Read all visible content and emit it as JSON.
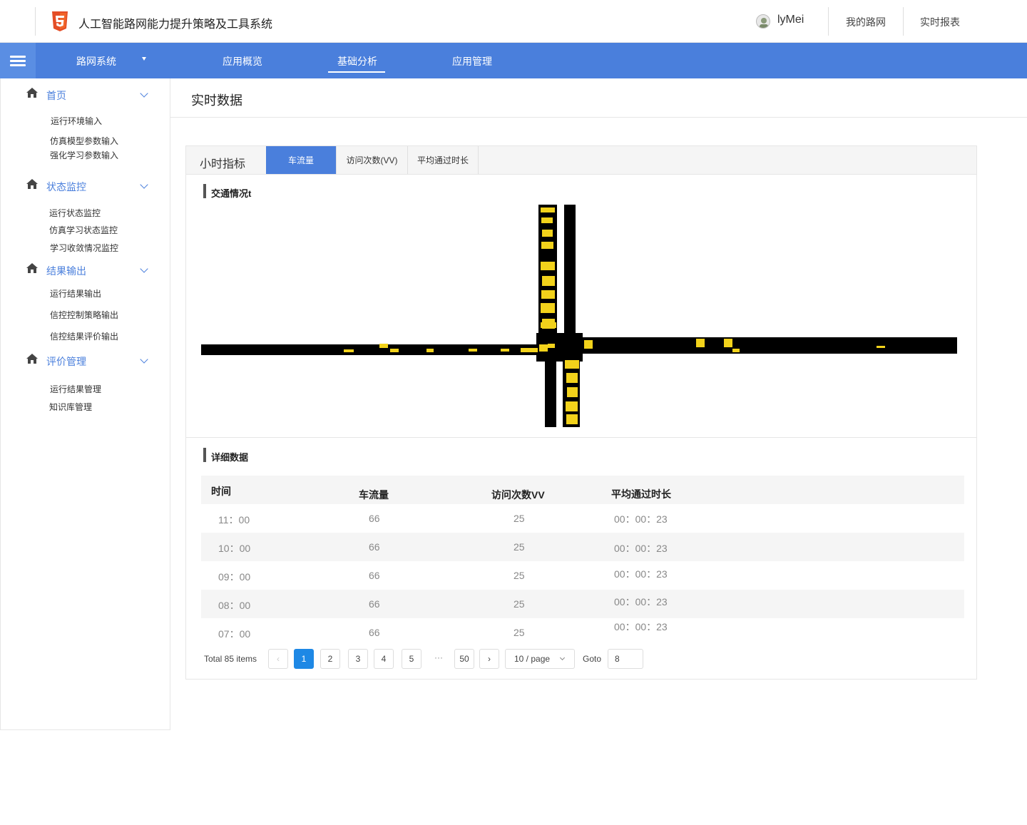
{
  "header": {
    "app_title": "人工智能路网能力提升策略及工具系统",
    "username": "lyMei",
    "links": [
      "我的路网",
      "实时报表"
    ]
  },
  "nav": {
    "system_label": "路网系统",
    "items": [
      "应用概览",
      "基础分析",
      "应用管理"
    ],
    "active": "基础分析",
    "accent_color": "#4a7fdc"
  },
  "sidebar": {
    "sections": [
      {
        "title": "首页",
        "icon": "home-icon",
        "items": [
          "运行环境输入",
          "仿真模型参数输入",
          "强化学习参数输入"
        ]
      },
      {
        "title": "状态监控",
        "icon": "home-icon",
        "items": [
          "运行状态监控",
          "仿真学习状态监控",
          "学习收敛情况监控"
        ]
      },
      {
        "title": "结果输出",
        "icon": "home-icon",
        "items": [
          "运行结果输出",
          "信控控制策略输出",
          "信控结果评价输出"
        ]
      },
      {
        "title": "评价管理",
        "icon": "home-icon",
        "items": [
          "运行结果管理",
          "知识库管理"
        ]
      }
    ]
  },
  "page": {
    "title": "实时数据",
    "tabs_label": "小时指标",
    "tabs": [
      "车流量",
      "访问次数(VV)",
      "平均通过时长"
    ],
    "active_tab": "车流量",
    "traffic_section": "交通情况t",
    "detail_section": "详细数据"
  },
  "table": {
    "columns": [
      "时间",
      "车流量",
      "访问次数VV",
      "平均通过时长"
    ],
    "rows": [
      [
        "11：00",
        "66",
        "25",
        "00：00：23"
      ],
      [
        "10：00",
        "66",
        "25",
        "00：00：23"
      ],
      [
        "09：00",
        "66",
        "25",
        "00：00：23"
      ],
      [
        "08：00",
        "66",
        "25",
        "00：00：23"
      ],
      [
        "07：00",
        "66",
        "25",
        "00：00：23"
      ]
    ]
  },
  "pagination": {
    "total": "Total 85 items",
    "prev": "‹",
    "next": "›",
    "pages": [
      "1",
      "2",
      "3",
      "4",
      "5"
    ],
    "ellipsis": "···",
    "last": "50",
    "current": "1",
    "page_size": "10 / page",
    "goto_label": "Goto",
    "goto_value": "8"
  }
}
